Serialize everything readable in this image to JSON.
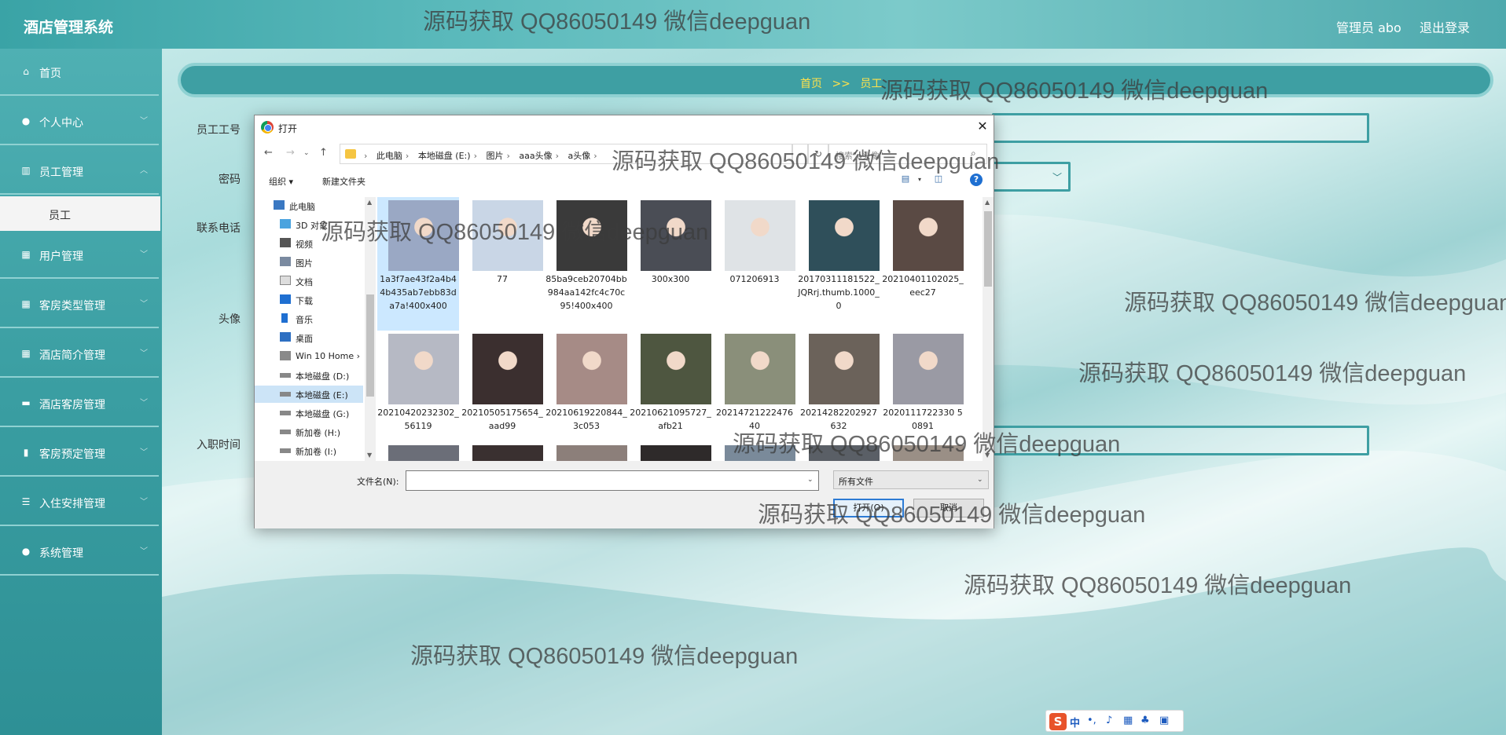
{
  "app": {
    "title": "酒店管理系统",
    "user": "管理员 abo",
    "logout": "退出登录"
  },
  "sidebar": {
    "items": [
      {
        "label": "首页",
        "icon": "home-icon"
      },
      {
        "label": "个人中心",
        "icon": "user-icon"
      },
      {
        "label": "员工管理",
        "icon": "chart-icon"
      },
      {
        "label": "用户管理",
        "icon": "grid-icon"
      },
      {
        "label": "客房类型管理",
        "icon": "grid-icon"
      },
      {
        "label": "酒店简介管理",
        "icon": "grid-icon"
      },
      {
        "label": "酒店客房管理",
        "icon": "comment-icon"
      },
      {
        "label": "客房预定管理",
        "icon": "bar-chart-icon"
      },
      {
        "label": "入住安排管理",
        "icon": "sliders-icon"
      },
      {
        "label": "系统管理",
        "icon": "user-icon"
      }
    ],
    "sub_item": "员工"
  },
  "breadcrumb": {
    "home": "首页",
    "sep": ">>",
    "current": "员工"
  },
  "form": {
    "labels": {
      "id": "员工工号",
      "password": "密码",
      "phone": "联系电话",
      "avatar": "头像",
      "hire_date": "入职时间"
    }
  },
  "dialog": {
    "title": "打开",
    "path": [
      "此电脑",
      "本地磁盘 (E:)",
      "图片",
      "aaa头像",
      "a头像"
    ],
    "search_placeholder": "搜索\"a头像\"",
    "toolbar": {
      "organize": "组织 ▾",
      "new_folder": "新建文件夹"
    },
    "tree": [
      {
        "label": "此电脑",
        "icon": "computer-icon"
      },
      {
        "label": "3D 对象",
        "icon": "cube-icon"
      },
      {
        "label": "视频",
        "icon": "video-icon"
      },
      {
        "label": "图片",
        "icon": "picture-icon"
      },
      {
        "label": "文档",
        "icon": "document-icon"
      },
      {
        "label": "下载",
        "icon": "download-icon"
      },
      {
        "label": "音乐",
        "icon": "music-icon"
      },
      {
        "label": "桌面",
        "icon": "desktop-icon"
      },
      {
        "label": "Win 10 Home ›",
        "icon": "drive-icon"
      },
      {
        "label": "本地磁盘 (D:)",
        "icon": "drive-icon"
      },
      {
        "label": "本地磁盘 (E:)",
        "icon": "drive-icon"
      },
      {
        "label": "本地磁盘 (G:)",
        "icon": "drive-icon"
      },
      {
        "label": "新加卷 (H:)",
        "icon": "drive-icon"
      },
      {
        "label": "新加卷 (I:)",
        "icon": "drive-icon"
      }
    ],
    "files": [
      {
        "name": "1a3f7ae43f2a4b44b435ab7ebb83da7a!400x400",
        "tone": "#9aa8c4"
      },
      {
        "name": "77",
        "tone": "#c9d6e6"
      },
      {
        "name": "85ba9ceb20704bb984aa142fc4c70c95!400x400",
        "tone": "#3a3a3a"
      },
      {
        "name": "300x300",
        "tone": "#4a4d55"
      },
      {
        "name": "071206913",
        "tone": "#dfe3e6"
      },
      {
        "name": "20170311181522_JQRrj.thumb.1000_0",
        "tone": "#2f4f5a"
      },
      {
        "name": "20210401102025_eec27",
        "tone": "#5a4a44"
      },
      {
        "name": "20210420232302_56119",
        "tone": "#b6b9c4"
      },
      {
        "name": "20210505175654_aad99",
        "tone": "#3b2f2f"
      },
      {
        "name": "20210619220844_3c053",
        "tone": "#a68b86"
      },
      {
        "name": "20210621095727_afb21",
        "tone": "#4e5640"
      },
      {
        "name": "2021472122247640",
        "tone": "#8a8f7a"
      },
      {
        "name": "20214282202927632",
        "tone": "#6b625a"
      },
      {
        "name": "2020111722330 50891",
        "tone": "#9a9aa4"
      }
    ],
    "filename_label": "文件名(N):",
    "filetype": "所有文件",
    "open_label": "打开(O)",
    "cancel_label": "取消"
  },
  "watermark": "源码获取 QQ86050149 微信deepguan",
  "ime": {
    "label": "S",
    "zh": "中"
  }
}
